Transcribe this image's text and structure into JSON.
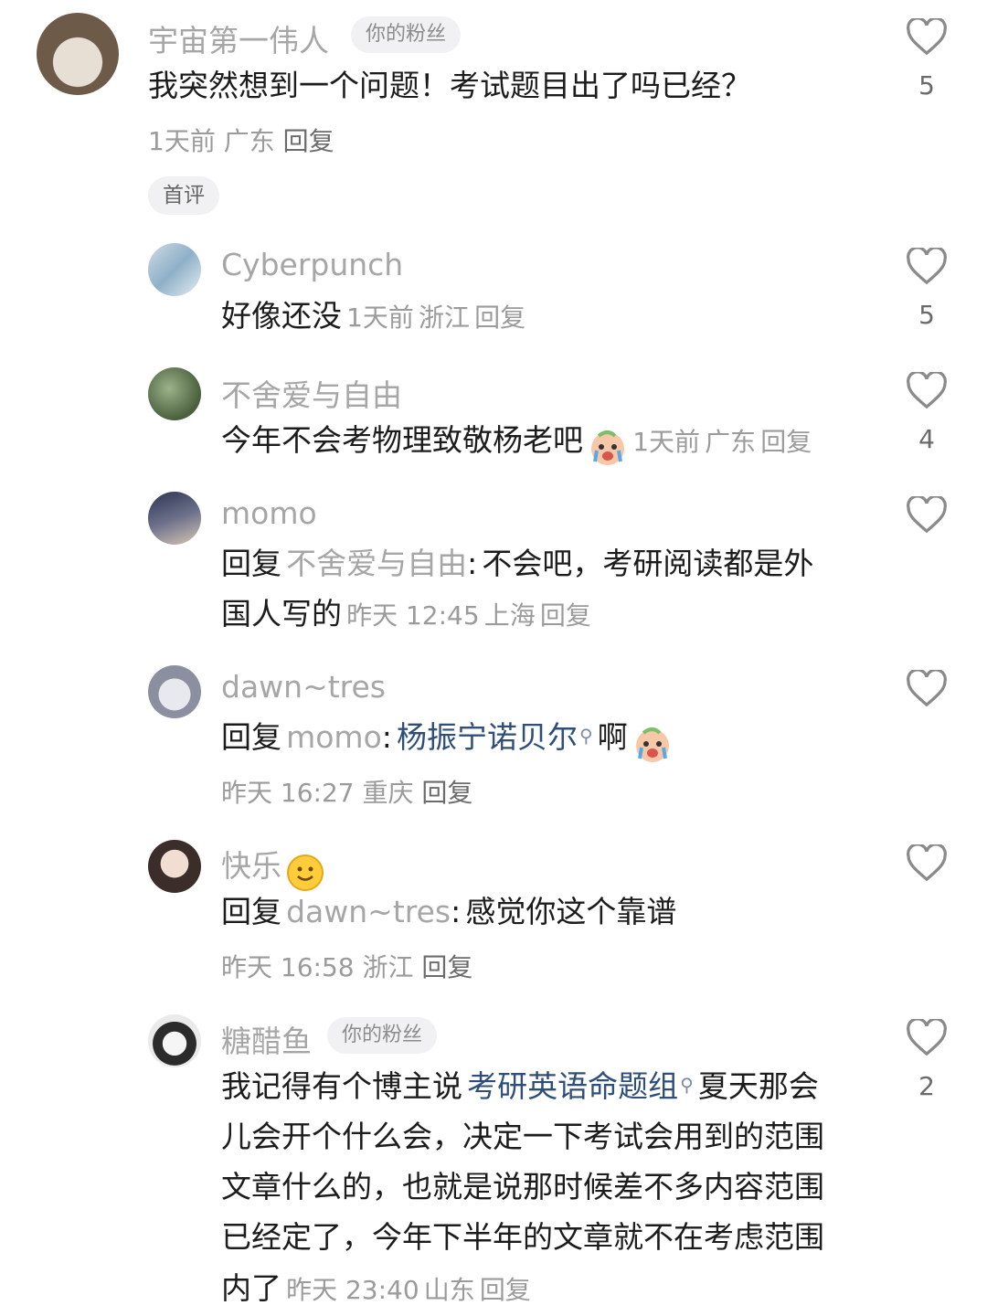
{
  "comments": [
    {
      "name": "宇宙第一伟人",
      "badge": "你的粉丝",
      "text": "我突然想到一个问题！考试题目出了吗已经？",
      "time": "1天前",
      "loc": "广东",
      "reply": "回复",
      "likes": "5",
      "tag": "首评"
    }
  ],
  "replies": [
    {
      "name": "Cyberpunch",
      "text": "好像还没",
      "time": "1天前",
      "loc": "浙江",
      "reply": "回复",
      "likes": "5"
    },
    {
      "name": "不舍爱与自由",
      "text": "今年不会考物理致敬杨老吧",
      "time": "1天前",
      "loc": "广东",
      "reply": "回复",
      "likes": "4"
    },
    {
      "name": "momo",
      "prefix": "回复",
      "target": "不舍爱与自由",
      "sep": ":",
      "text1": "不会吧，考研阅读都是外",
      "text2": "国人写的",
      "time": "昨天 12:45",
      "loc": "上海",
      "reply": "回复",
      "likes": ""
    },
    {
      "name": "dawn~tres",
      "prefix": "回复",
      "target": "momo",
      "sep": ":",
      "link": "杨振宁诺贝尔",
      "text_after": "啊",
      "time": "昨天 16:27",
      "loc": "重庆",
      "reply": "回复",
      "likes": ""
    },
    {
      "name": "快乐",
      "prefix": "回复",
      "target": "dawn~tres",
      "sep": ":",
      "text": "感觉你这个靠谱",
      "time": "昨天 16:58",
      "loc": "浙江",
      "reply": "回复",
      "likes": ""
    },
    {
      "name": "糖醋鱼",
      "badge": "你的粉丝",
      "text_before": "我记得有个博主说",
      "link": "考研英语命题组",
      "lines": [
        "夏天那会",
        "儿会开个什么会，决定一下考试会用到的范围",
        "文章什么的，也就是说那时候差不多内容范围",
        "已经定了，今年下半年的文章就不在考虑范围",
        "内了"
      ],
      "time": "昨天 23:40",
      "loc": "山东",
      "reply": "回复",
      "likes": "2"
    }
  ],
  "colors": {
    "name": "#a6a6a6",
    "link": "#2f4f7a",
    "heart": "#8a8a8a"
  }
}
